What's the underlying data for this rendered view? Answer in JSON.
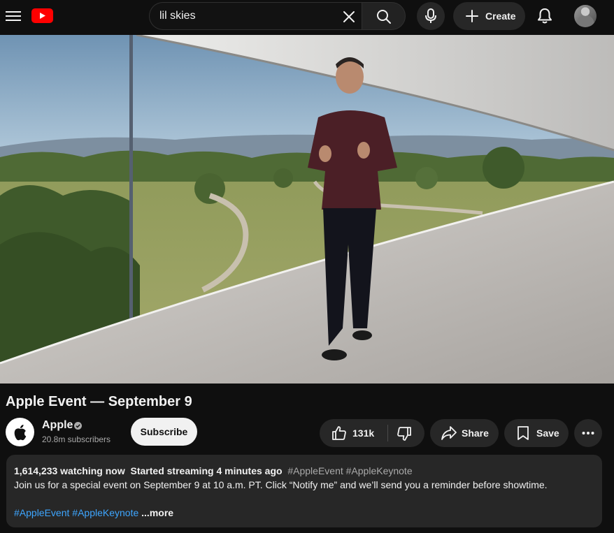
{
  "header": {
    "search_value": "lil skies",
    "create_label": "Create"
  },
  "video": {
    "title": "Apple Event — September 9"
  },
  "channel": {
    "name": "Apple",
    "subscribers": "20.8m subscribers",
    "subscribe_label": "Subscribe"
  },
  "actions": {
    "like_count": "131k",
    "share_label": "Share",
    "save_label": "Save"
  },
  "description": {
    "viewers": "1,614,233 watching now",
    "started": "Started streaming 4 minutes ago",
    "header_tags": "#AppleEvent #AppleKeynote",
    "text": "Join us for a special event on September 9 at 10 a.m. PT. Click “Notify me” and we’ll send you a reminder before showtime.",
    "tags": [
      "#AppleEvent",
      "#AppleKeynote"
    ],
    "more_label": "...more"
  },
  "colors": {
    "background": "#0f0f0f",
    "surface": "#272727",
    "brand_red": "#ff0000",
    "link_blue": "#3ea6ff",
    "secondary_text": "#aaaaaa"
  },
  "icons": [
    "menu-icon",
    "youtube-logo-icon",
    "clear-icon",
    "search-icon",
    "microphone-icon",
    "plus-icon",
    "bell-icon",
    "apple-logo-icon",
    "verified-icon",
    "thumbs-up-icon",
    "thumbs-down-icon",
    "share-arrow-icon",
    "bookmark-icon",
    "more-dots-icon"
  ]
}
